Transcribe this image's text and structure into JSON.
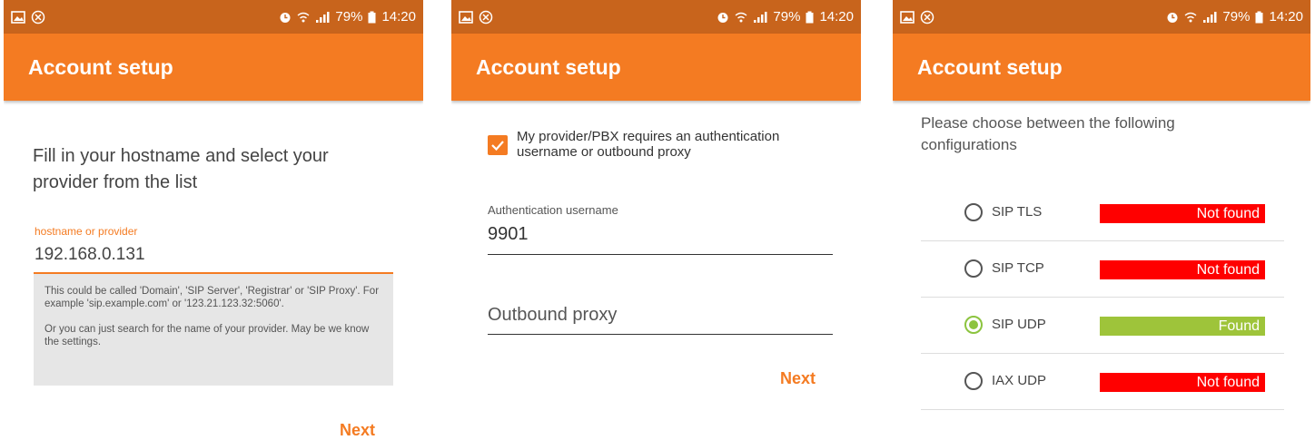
{
  "status_bar": {
    "battery": "79%",
    "time": "14:20"
  },
  "colors": {
    "accent": "#f47b22",
    "status_bar": "#c8641c",
    "not_found": "#ff0000",
    "found": "#9ec43a"
  },
  "screen1": {
    "title": "Account setup",
    "intro": "Fill in your hostname and select your provider from the list",
    "field_label": "hostname or provider",
    "field_value": "192.168.0.131",
    "help_p1": "This could be called 'Domain', 'SIP Server', 'Registrar' or 'SIP Proxy'. For example 'sip.example.com' or '123.21.123.32:5060'.",
    "help_p2": "Or you can just search for the name of your provider. May be we know the settings.",
    "next": "Next"
  },
  "screen2": {
    "title": "Account setup",
    "checkbox_label": "My provider/PBX requires an authentication username or outbound proxy",
    "checkbox_checked": true,
    "auth_label": "Authentication username",
    "auth_value": "9901",
    "proxy_placeholder": "Outbound proxy",
    "next": "Next"
  },
  "screen3": {
    "title": "Account setup",
    "prompt": "Please choose between the following configurations",
    "options": [
      {
        "label": "SIP TLS",
        "status": "Not found",
        "selected": false
      },
      {
        "label": "SIP TCP",
        "status": "Not found",
        "selected": false
      },
      {
        "label": "SIP UDP",
        "status": "Found",
        "selected": true
      },
      {
        "label": "IAX UDP",
        "status": "Not found",
        "selected": false
      }
    ]
  }
}
